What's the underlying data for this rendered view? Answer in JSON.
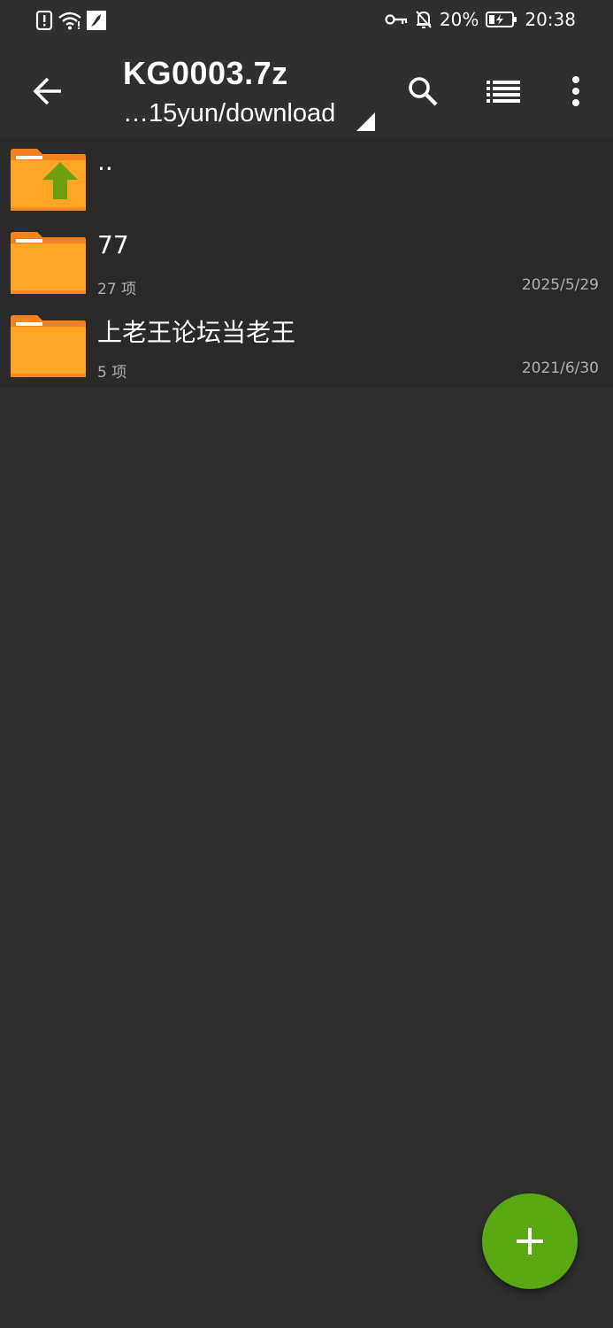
{
  "status_bar": {
    "left_icons": [
      "alert-icon",
      "wifi-icon",
      "app-notification-icon"
    ],
    "right_icons": [
      "key-icon",
      "bell-off-icon",
      "battery-charging-icon"
    ],
    "battery": "20%",
    "time": "20:38"
  },
  "app_bar": {
    "title": "KG0003.7z",
    "path": "…15yun/download",
    "icons": [
      "back-arrow-icon",
      "search-icon",
      "list-view-icon",
      "more-vert-icon"
    ]
  },
  "files": [
    {
      "name": "..",
      "meta": "",
      "date": "",
      "icon": "folder-up-icon"
    },
    {
      "name": "77",
      "meta": "27 项",
      "date": "2025/5/29",
      "icon": "folder-icon"
    },
    {
      "name": "上老王论坛当老王",
      "meta": "5 项",
      "date": "2021/6/30",
      "icon": "folder-icon"
    }
  ],
  "fab": {
    "icon": "plus-icon"
  },
  "colors": {
    "background": "#303030",
    "list_background": "#2a2a2a",
    "folder_orange": "#ffa526",
    "folder_tab": "#f4811d",
    "up_arrow_green": "#6e9f0f",
    "fab_green": "#5aa814"
  }
}
